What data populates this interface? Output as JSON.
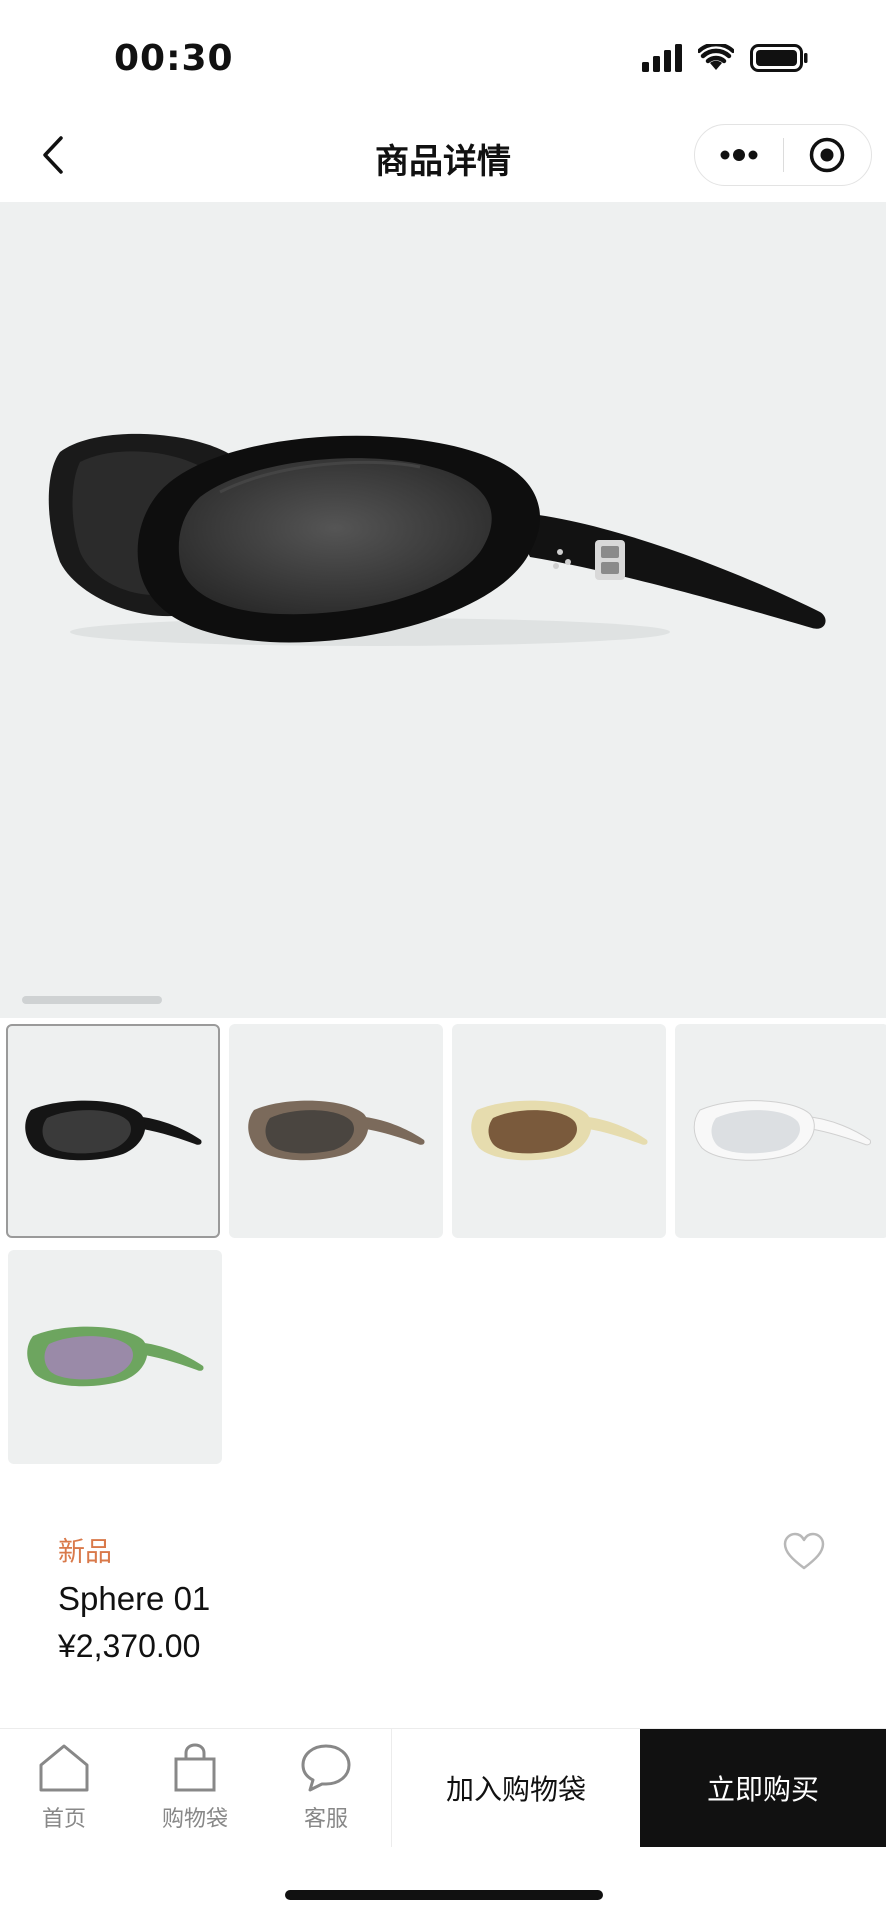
{
  "status_bar": {
    "time": "00:30"
  },
  "nav": {
    "title": "商品详情"
  },
  "product": {
    "badge": "新品",
    "name": "Sphere 01",
    "price": "¥2,370.00",
    "variants": [
      {
        "frame": "#151515",
        "lens": "#3a3a3a",
        "selected": true
      },
      {
        "frame": "#7b6a5b",
        "lens": "#4a4540",
        "selected": false
      },
      {
        "frame": "#e6dcae",
        "lens": "#7a5a3c",
        "selected": false
      },
      {
        "frame": "#f4f4f4",
        "lens": "#dcdfe2",
        "selected": false
      },
      {
        "frame": "#6da55f",
        "lens": "#9a8aa8",
        "selected": false
      }
    ]
  },
  "tabs": [
    {
      "label": "首页",
      "icon": "home-icon"
    },
    {
      "label": "购物袋",
      "icon": "shopping-bag-icon"
    },
    {
      "label": "客服",
      "icon": "chat-bubble-icon"
    }
  ],
  "actions": {
    "add_to_cart": "加入购物袋",
    "buy_now": "立即购买"
  },
  "colors": {
    "accent_badge": "#d9794a",
    "buy_button_bg": "#111111"
  }
}
